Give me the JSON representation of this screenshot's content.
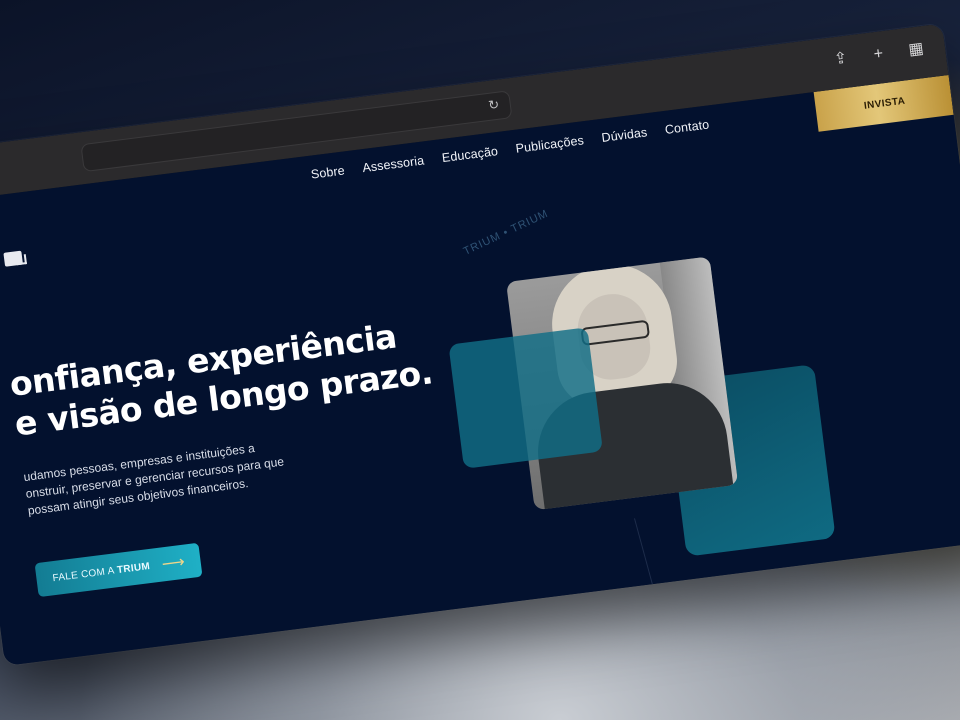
{
  "browser": {
    "reload_icon": "reload-icon",
    "icons": [
      "share-icon",
      "plus-icon",
      "tabs-grid-icon"
    ]
  },
  "nav": {
    "items": [
      "Sobre",
      "Assessoria",
      "Educação",
      "Publicações",
      "Dúvidas",
      "Contato"
    ],
    "invest_label": "INVISTA"
  },
  "hero": {
    "title_line1": "onfiança, experiência",
    "title_line2": "e visão de longo prazo.",
    "sub_line1": "udamos pessoas, empresas e instituições a",
    "sub_line2": "onstruir, preservar e gerenciar recursos para que",
    "sub_line3": "possam atingir seus objetivos financeiros.",
    "cta_prefix": "FALE COM A",
    "cta_brand": "TRIUM",
    "ring_text": "TRIUM • TRIUM"
  },
  "colors": {
    "background": "#03112e",
    "accent_gold": "#c9a24a",
    "accent_teal": "#1fb0c6"
  }
}
